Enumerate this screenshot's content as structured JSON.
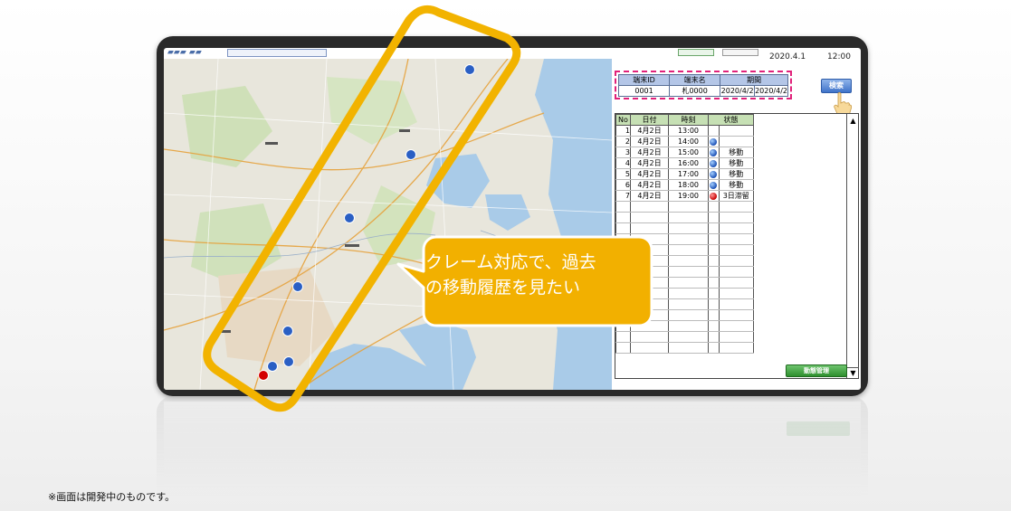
{
  "header": {
    "date": "2020.4.1",
    "time": "12:00"
  },
  "search": {
    "headers": [
      "端末ID",
      "端末名",
      "期間"
    ],
    "values": [
      "0001",
      "札0000",
      "2020/4/2",
      "2020/4/2"
    ],
    "button_label": "検索"
  },
  "results": {
    "headers": [
      "No",
      "日付",
      "時刻",
      "状態"
    ],
    "rows": [
      {
        "no": "1",
        "date": "4月2日",
        "time": "13:00",
        "icon": "",
        "state": ""
      },
      {
        "no": "2",
        "date": "4月2日",
        "time": "14:00",
        "icon": "blue",
        "state": ""
      },
      {
        "no": "3",
        "date": "4月2日",
        "time": "15:00",
        "icon": "blue",
        "state": "移動"
      },
      {
        "no": "4",
        "date": "4月2日",
        "time": "16:00",
        "icon": "blue",
        "state": "移動"
      },
      {
        "no": "5",
        "date": "4月2日",
        "time": "17:00",
        "icon": "blue",
        "state": "移動"
      },
      {
        "no": "6",
        "date": "4月2日",
        "time": "18:00",
        "icon": "blue",
        "state": "移動"
      },
      {
        "no": "7",
        "date": "4月2日",
        "time": "19:00",
        "icon": "red",
        "state": "3日滞留"
      }
    ],
    "empty_row_count": 14
  },
  "scroll": {
    "up": "▲",
    "down": "▼"
  },
  "action_button_label": "動態管理",
  "callout": {
    "line1": "クレーム対応で、過去",
    "line2": "の移動履歴を見たい"
  },
  "footnote": "※画面は開発中のものです。",
  "colors": {
    "highlight_orange": "#f5b400",
    "callout_fill": "#f2b000",
    "search_dash": "#e0217a",
    "results_header": "#c6e0b4",
    "search_header": "#b4c6e7"
  },
  "map_markers": [
    {
      "color": "blue"
    },
    {
      "color": "blue"
    },
    {
      "color": "blue"
    },
    {
      "color": "blue"
    },
    {
      "color": "blue"
    },
    {
      "color": "blue"
    },
    {
      "color": "blue"
    },
    {
      "color": "red"
    }
  ]
}
